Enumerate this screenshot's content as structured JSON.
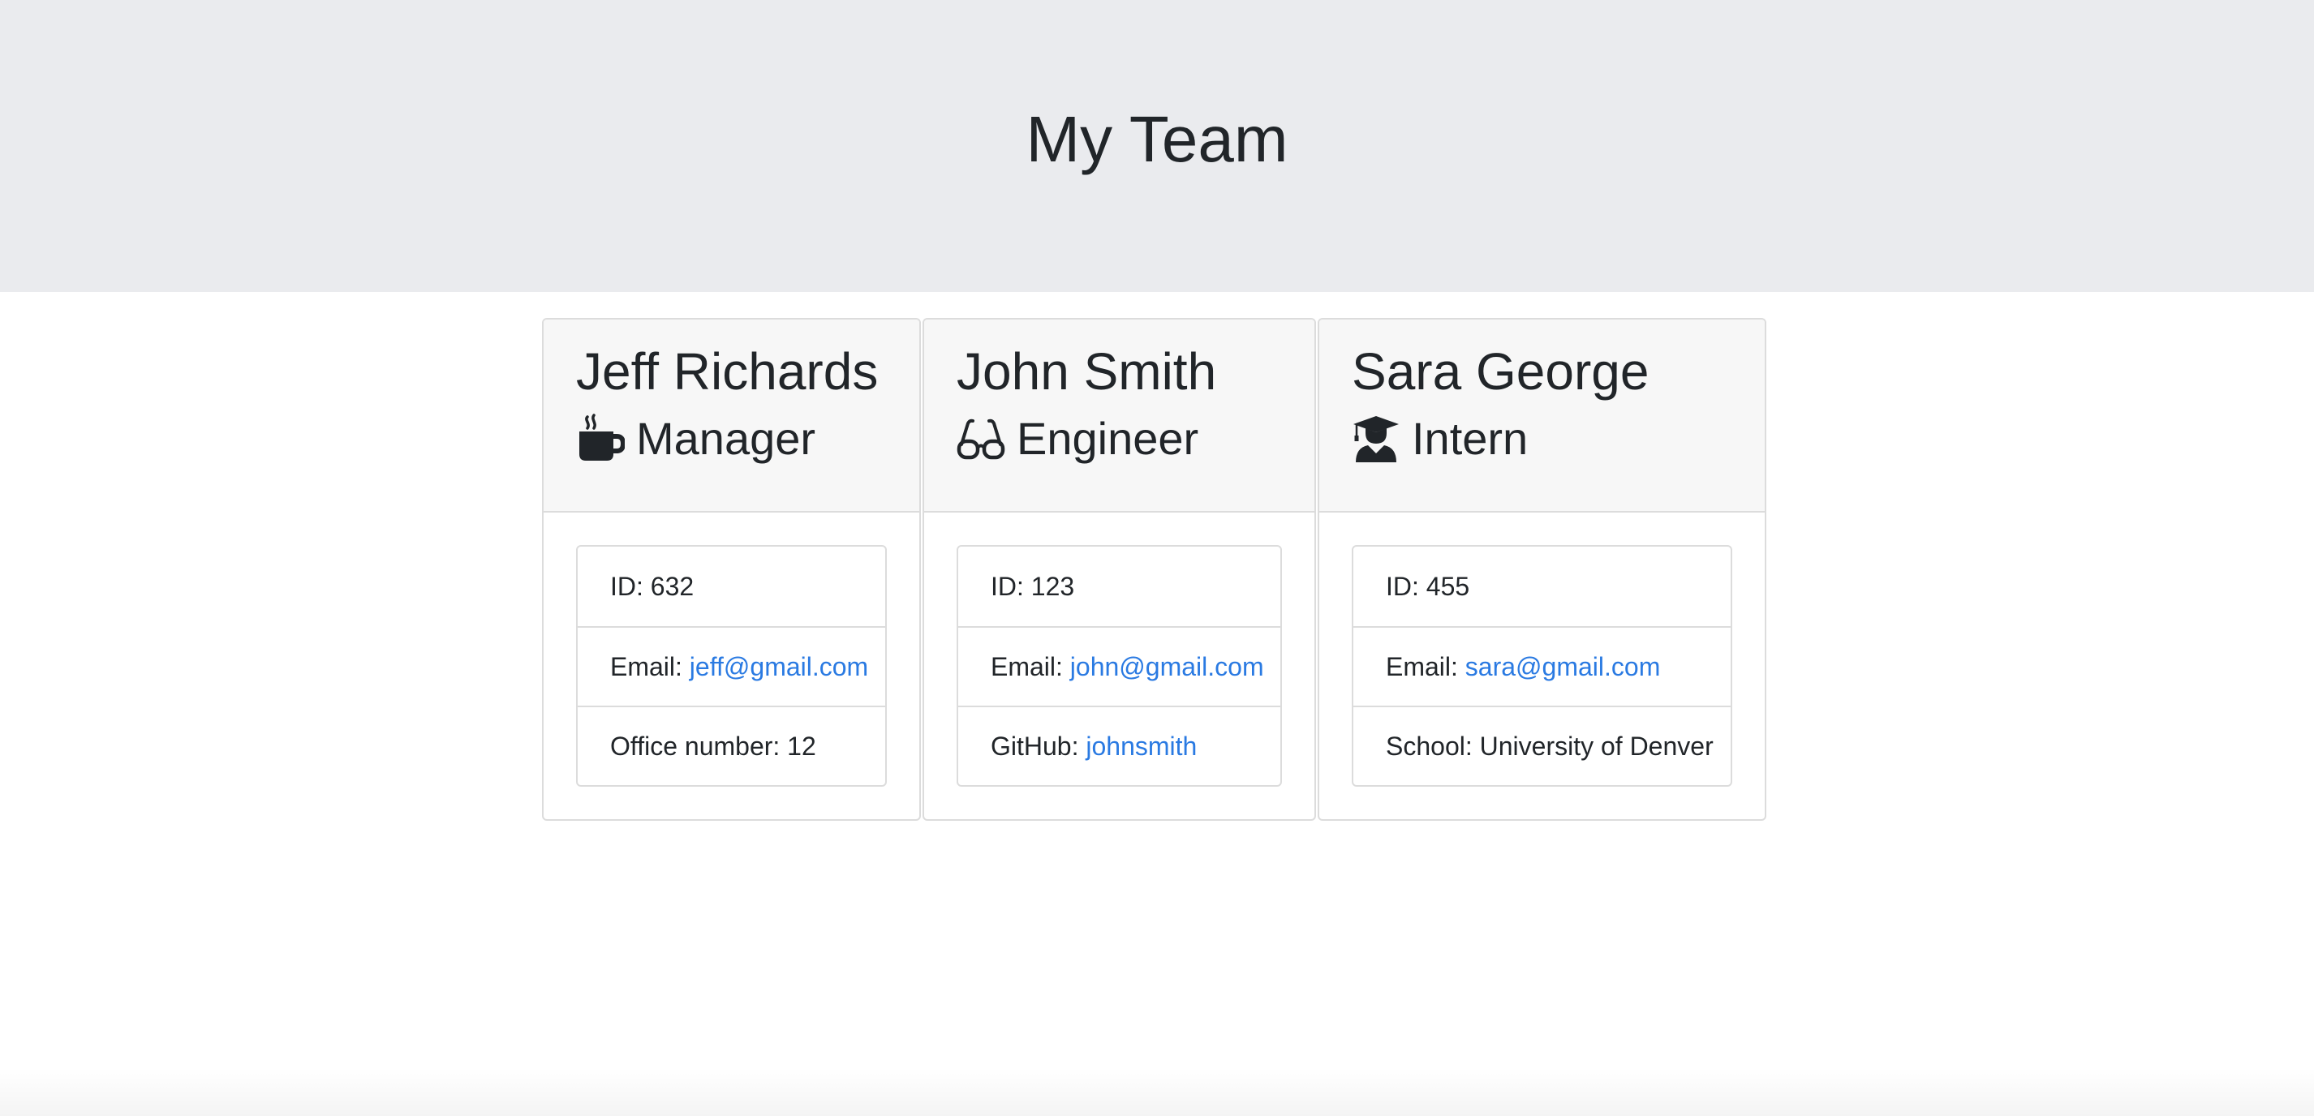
{
  "header": {
    "title": "My Team"
  },
  "colors": {
    "jumbotron_bg": "#eaebee",
    "link": "#2a7ae2",
    "text": "#212529"
  },
  "cards": [
    {
      "name": "Jeff Richards",
      "role": "Manager",
      "role_icon": "coffee-mug-icon",
      "id_label": "ID:",
      "id_value": "632",
      "email_label": "Email:",
      "email_value": "jeff@gmail.com",
      "extra_label": "Office number:",
      "extra_value": "12"
    },
    {
      "name": "John Smith",
      "role": "Engineer",
      "role_icon": "glasses-icon",
      "id_label": "ID:",
      "id_value": "123",
      "email_label": "Email:",
      "email_value": "john@gmail.com",
      "extra_label": "GitHub:",
      "extra_value": "johnsmith"
    },
    {
      "name": "Sara George",
      "role": "Intern",
      "role_icon": "graduate-icon",
      "id_label": "ID:",
      "id_value": "455",
      "email_label": "Email:",
      "email_value": "sara@gmail.com",
      "extra_label": "School:",
      "extra_value": "University of Denver"
    }
  ]
}
